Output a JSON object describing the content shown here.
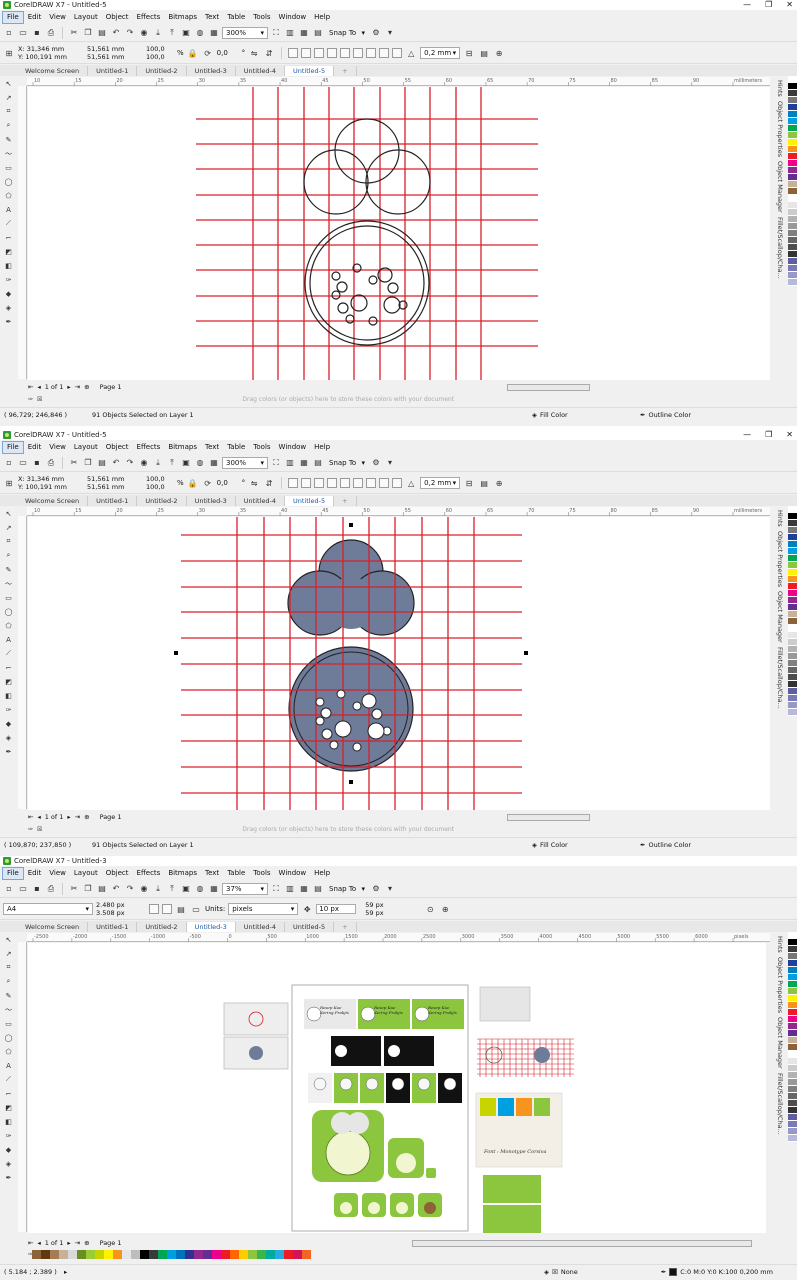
{
  "windows": [
    {
      "title": "CorelDRAW X7 - Untitled-5",
      "menu": [
        "File",
        "Edit",
        "View",
        "Layout",
        "Object",
        "Effects",
        "Bitmaps",
        "Text",
        "Table",
        "Tools",
        "Window",
        "Help"
      ],
      "zoom": "300%",
      "snap": "Snap To",
      "props": {
        "x": "X: 31,346 mm",
        "y": "Y: 100,191 mm",
        "w": "51,561 mm",
        "h": "51,561 mm",
        "sx": "100,0",
        "sy": "100,0",
        "pct": "%",
        "rot": "0,0",
        "deg": "°",
        "outline": "0,2 mm"
      },
      "tabs": [
        "Welcome Screen",
        "Untitled-1",
        "Untitled-2",
        "Untitled-3",
        "Untitled-4",
        "Untitled-5",
        "+"
      ],
      "active_tab": 5,
      "ruler_labels": [
        "10",
        "15",
        "20",
        "25",
        "30",
        "35",
        "40",
        "45",
        "50",
        "55",
        "60",
        "65",
        "70",
        "75",
        "80",
        "85",
        "90",
        "millimeters"
      ],
      "dock": [
        "Hints",
        "Object Properties",
        "Object Manager",
        "Fillet/Scallop/Cha..."
      ],
      "page_nav": {
        "pos": "1 of 1",
        "page": "Page 1"
      },
      "drop_hint": "Drag colors (or objects) here to store these colors with your document",
      "status": {
        "coords": "( 96,729; 246,846 )",
        "sel": "91 Objects Selected on Layer 1",
        "fill": "Fill Color",
        "outline": "Outline Color"
      }
    },
    {
      "title": "CorelDRAW X7 - Untitled-5",
      "menu": [
        "File",
        "Edit",
        "View",
        "Layout",
        "Object",
        "Effects",
        "Bitmaps",
        "Text",
        "Table",
        "Tools",
        "Window",
        "Help"
      ],
      "zoom": "300%",
      "snap": "Snap To",
      "props": {
        "x": "X: 31,346 mm",
        "y": "Y: 100,191 mm",
        "w": "51,561 mm",
        "h": "51,561 mm",
        "sx": "100,0",
        "sy": "100,0",
        "pct": "%",
        "rot": "0,0",
        "deg": "°",
        "outline": "0,2 mm"
      },
      "tabs": [
        "Welcome Screen",
        "Untitled-1",
        "Untitled-2",
        "Untitled-3",
        "Untitled-4",
        "Untitled-5",
        "+"
      ],
      "active_tab": 5,
      "ruler_labels": [
        "10",
        "15",
        "20",
        "25",
        "30",
        "35",
        "40",
        "45",
        "50",
        "55",
        "60",
        "65",
        "70",
        "75",
        "80",
        "85",
        "90",
        "millimeters"
      ],
      "dock": [
        "Hints",
        "Object Properties",
        "Object Manager",
        "Fillet/Scallop/Cha..."
      ],
      "page_nav": {
        "pos": "1 of 1",
        "page": "Page 1"
      },
      "drop_hint": "Drag colors (or objects) here to store these colors with your document",
      "status": {
        "coords": "( 109,870; 237,850 )",
        "sel": "91 Objects Selected on Layer 1",
        "fill": "Fill Color",
        "outline": "Outline Color"
      }
    },
    {
      "title": "CorelDRAW X7 - Untitled-3",
      "menu": [
        "File",
        "Edit",
        "View",
        "Layout",
        "Object",
        "Effects",
        "Bitmaps",
        "Text",
        "Table",
        "Tools",
        "Window",
        "Help"
      ],
      "zoom": "37%",
      "snap": "Snap To",
      "props": {
        "page": "A4",
        "w": "2.480 px",
        "h": "3.508 px",
        "units_label": "Units:",
        "units": "pixels",
        "nudge": "10 px",
        "dup_x": "59 px",
        "dup_y": "59 px"
      },
      "tabs": [
        "Welcome Screen",
        "Untitled-1",
        "Untitled-2",
        "Untitled-3",
        "Untitled-4",
        "Untitled-5",
        "+"
      ],
      "active_tab": 3,
      "ruler_labels": [
        "-2500",
        "-2000",
        "-1500",
        "-1000",
        "-500",
        "0",
        "500",
        "1000",
        "1500",
        "2000",
        "2500",
        "3000",
        "3500",
        "4000",
        "4500",
        "5000",
        "5500",
        "6000",
        "pixels"
      ],
      "dock": [
        "Hints",
        "Object Properties",
        "Object Manager",
        "Fillet/Scallop/Cha..."
      ],
      "page_nav": {
        "pos": "1 of 1",
        "page": "Page 1"
      },
      "doc_text": {
        "brand": "Resep Kue Kering Prakjis",
        "font_caption": "Font : Monotype Corsiva"
      },
      "status": {
        "coords": "( 5.184 ; 2.389 )",
        "fill": "None",
        "outline": "C:0 M:0 Y:0 K:100  0,200 mm"
      }
    }
  ],
  "colors": {
    "grid_red": "#d6202a",
    "shape_fill": "#6e7b99",
    "brand_green": "#8cc63f",
    "accent_blue": "#1e5aa8"
  },
  "palette_vertical": [
    "#ffffff",
    "#000000",
    "#3a3a3a",
    "#777777",
    "#1e3f9c",
    "#0080c0",
    "#00a0e0",
    "#00a651",
    "#8cc63f",
    "#fff200",
    "#f7941d",
    "#ed1c24",
    "#ec008c",
    "#92278f",
    "#662d91",
    "#c7b299",
    "#8c6239",
    "#ffffff",
    "#e6e6e6",
    "#cccccc",
    "#b3b3b3",
    "#999999",
    "#808080",
    "#666666",
    "#4d4d4d",
    "#333333",
    "#5e5ea0",
    "#7a7ab8",
    "#9898c8",
    "#b8b8dc"
  ],
  "palette_horizontal": [
    "#8c6239",
    "#603913",
    "#a67c52",
    "#c7b299",
    "#d9d9d9",
    "#6b8e23",
    "#9acd32",
    "#c8d400",
    "#fff200",
    "#f7941d",
    "#e6e6e6",
    "#bdbdbd",
    "#000000",
    "#3a3a3a",
    "#00a651",
    "#00a0e0",
    "#0072bc",
    "#2e3192",
    "#92278f",
    "#662d91",
    "#ec008c",
    "#ed1c24",
    "#ff6600",
    "#ffcc00",
    "#8cc63f",
    "#39b54a",
    "#00a99d",
    "#27aae1",
    "#ed1c24",
    "#d4145a",
    "#f26522"
  ]
}
